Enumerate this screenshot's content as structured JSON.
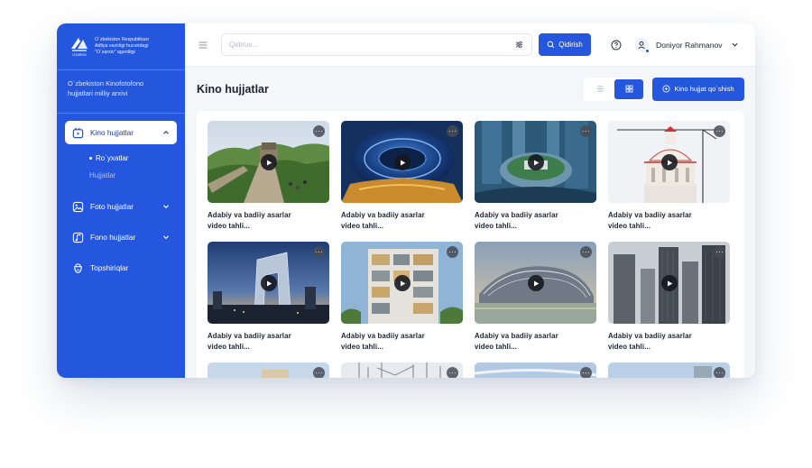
{
  "sidebar": {
    "org_text": "O`zbekiston Respublikasi\nAdliya vazirligi huzuridagi\n\"O`zarxiv\" agentligi",
    "logo_caption": "O'ZARXIV",
    "archive_name": "O`zbekiston Kinofotofono\nhujjatlari milliy arxivi",
    "items": [
      {
        "label": "Kino hujjatlar",
        "icon": "film-icon",
        "active": true,
        "expanded": true,
        "children": [
          {
            "label": "Ro`yxatlar",
            "active": true
          },
          {
            "label": "Hujjatlar",
            "active": false
          }
        ]
      },
      {
        "label": "Foto hujjatlar",
        "icon": "photo-icon",
        "expanded": false
      },
      {
        "label": "Fono hujjatlar",
        "icon": "music-icon",
        "expanded": false
      },
      {
        "label": "Topshiriqlar",
        "icon": "tasks-icon"
      }
    ]
  },
  "topbar": {
    "search_placeholder": "Qidiruv...",
    "search_value": "",
    "search_button": "Qidirish",
    "user_name": "Doniyor Rahmanov"
  },
  "page": {
    "title": "Kino hujjatlar",
    "add_button": "Kino hujjat qo`shish",
    "view_mode": "grid"
  },
  "cards": [
    {
      "title": "Adabiy va badiiy  asarlar\nvideo tahli...",
      "scene": "great-wall"
    },
    {
      "title": "Adabiy va badiiy  asarlar\nvideo tahli...",
      "scene": "blue-dome"
    },
    {
      "title": "Adabiy va badiiy  asarlar\nvideo tahli...",
      "scene": "tower-aerial"
    },
    {
      "title": "Adabiy va badiiy  asarlar\nvideo tahli...",
      "scene": "capitol-crane"
    },
    {
      "title": "Adabiy va badiiy  asarlar\nvideo tahli...",
      "scene": "cctv-dusk"
    },
    {
      "title": "Adabiy va badiiy  asarlar\nvideo tahli...",
      "scene": "apartment-block"
    },
    {
      "title": "Adabiy va badiiy  asarlar\nvideo tahli...",
      "scene": "curved-roof"
    },
    {
      "title": "Adabiy va badiiy  asarlar\nvideo tahli...",
      "scene": "skyscrapers-grey"
    },
    {
      "title": "",
      "scene": "sky-1"
    },
    {
      "title": "",
      "scene": "trees-2"
    },
    {
      "title": "",
      "scene": "sky-3"
    },
    {
      "title": "",
      "scene": "sky-4"
    }
  ],
  "colors": {
    "primary": "#2457dd",
    "background": "#f4f6fa",
    "text": "#1c2433"
  }
}
